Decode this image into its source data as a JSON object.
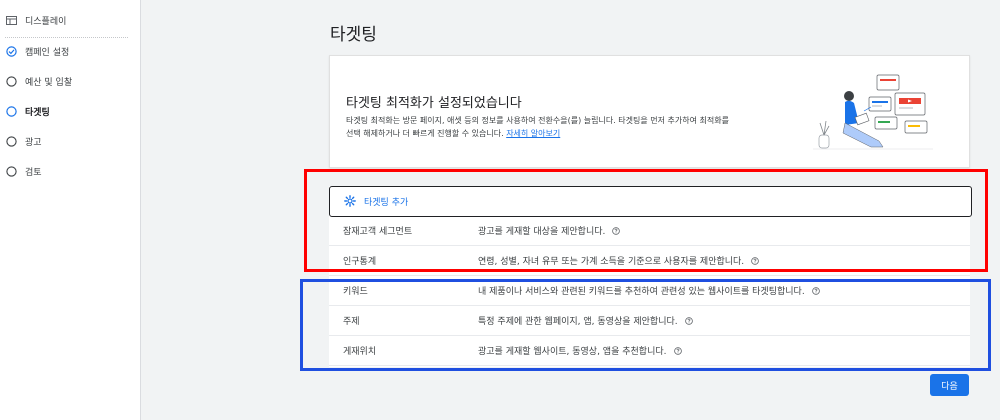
{
  "sidebar": {
    "items": [
      {
        "label": "디스플레이",
        "icon": "display-icon"
      },
      {
        "label": "캠페인 설정",
        "icon": "check-circle-icon"
      },
      {
        "label": "예산 및 입찰",
        "icon": "circle-icon"
      },
      {
        "label": "타겟팅",
        "icon": "circle-active-icon"
      },
      {
        "label": "광고",
        "icon": "circle-icon"
      },
      {
        "label": "검토",
        "icon": "circle-icon"
      }
    ]
  },
  "page": {
    "title": "타겟팅"
  },
  "hero": {
    "title": "타겟팅 최적화가 설정되었습니다",
    "desc_line1": "타겟팅 최적화는 방문 페이지, 애셋 등의 정보를 사용하여 전환수을(를) 늘립니다. 타겟팅을 먼저 추가하여 최적화를",
    "desc_line2": "선택 해제하거나 더 빠르게 진행할 수 있습니다.",
    "link": "자세히 알아보기"
  },
  "targeting": {
    "add_label": "타겟팅 추가",
    "rows": [
      {
        "name": "잠재고객 세그먼트",
        "desc": "광고를 게재할 대상을 제안합니다."
      },
      {
        "name": "인구통계",
        "desc": "연령, 성별, 자녀 유무 또는 가계 소득을 기준으로 사용자를 제안합니다."
      },
      {
        "name": "키워드",
        "desc": "내 제품이나 서비스와 관련된 키워드를 추천하여 관련성 있는 웹사이트를 타겟팅합니다."
      },
      {
        "name": "주제",
        "desc": "특정 주제에 관한 웹페이지, 앱, 동영상을 제안합니다."
      },
      {
        "name": "게재위치",
        "desc": "광고를 게재할 웹사이트, 동영상, 앱을 추천합니다."
      }
    ]
  },
  "footer": {
    "next_label": "다음"
  },
  "colors": {
    "accent": "#1a73e8",
    "highlight_red": "#ff0000",
    "highlight_blue": "#1f4fe0"
  }
}
